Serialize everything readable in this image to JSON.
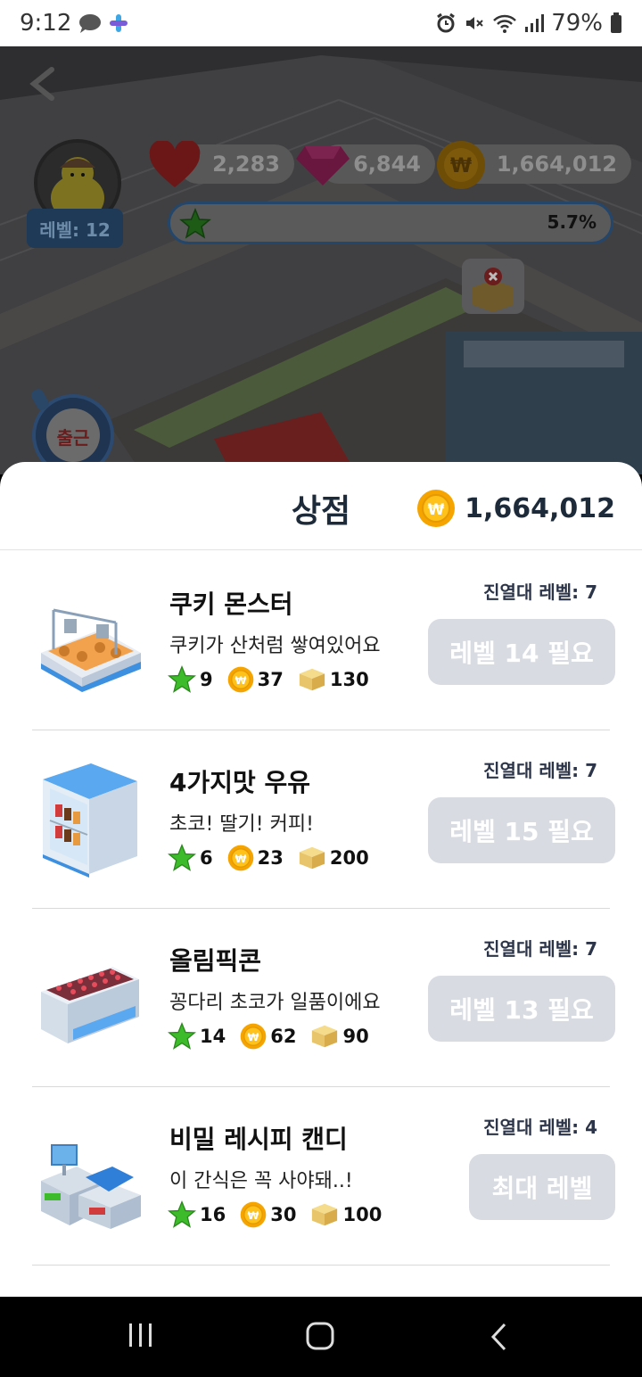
{
  "status_bar": {
    "time": "9:12",
    "battery": "79%"
  },
  "hud": {
    "level": "레벨: 12",
    "hearts": "2,283",
    "gems": "6,844",
    "coins": "1,664,012",
    "xp_percent": "5.7%",
    "xp_fraction": 0.057
  },
  "shop": {
    "title": "상점",
    "coins": "1,664,012",
    "items": [
      {
        "name": "쿠키 몬스터",
        "desc": "쿠키가 산처럼 쌓여있어요",
        "star": "9",
        "coin": "37",
        "box": "130",
        "display_level": "진열대 레벨: 7",
        "button": "레벨 14 필요"
      },
      {
        "name": "4가지맛 우유",
        "desc": "초코! 딸기! 커피!",
        "star": "6",
        "coin": "23",
        "box": "200",
        "display_level": "진열대 레벨: 7",
        "button": "레벨 15 필요"
      },
      {
        "name": "올림픽콘",
        "desc": "꽁다리 초코가 일품이에요",
        "star": "14",
        "coin": "62",
        "box": "90",
        "display_level": "진열대 레벨: 7",
        "button": "레벨 13 필요"
      },
      {
        "name": "비밀 레시피 캔디",
        "desc": "이 간식은 꼭 사야돼..!",
        "star": "16",
        "coin": "30",
        "box": "100",
        "display_level": "진열대 레벨: 4",
        "button": "최대 레벨"
      }
    ]
  },
  "icons": {
    "star": "star-icon",
    "coin": "coin-icon",
    "box": "box-icon",
    "heart": "heart-icon",
    "gem": "gem-icon"
  },
  "colors": {
    "accent_coin": "#f5a400",
    "star_green": "#3dbb2a",
    "button_disabled": "#d8dbe2"
  }
}
